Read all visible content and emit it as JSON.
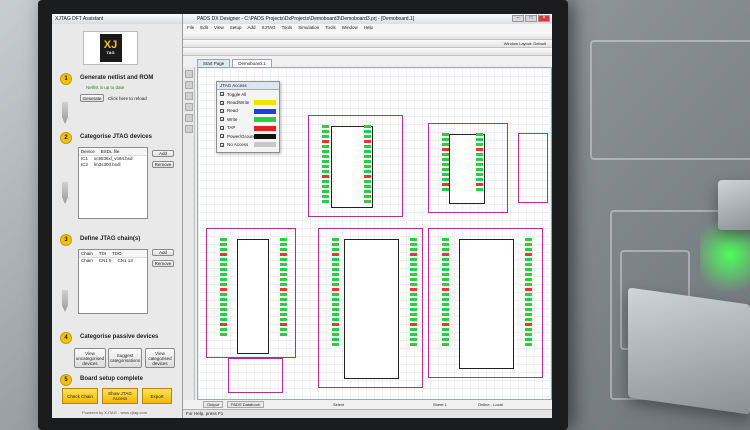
{
  "xjtag": {
    "title": "XJTAG DFT Assistant",
    "logo_main": "XJ",
    "logo_sub": "TAG",
    "steps": [
      {
        "num": "1",
        "title": "Generate netlist and ROM",
        "sub": "Netlist is up to date",
        "button": "Generate",
        "hint": "Click here to reload"
      },
      {
        "num": "2",
        "title": "Categorise JTAG devices",
        "headers": [
          "Device",
          "BSDL file"
        ],
        "rows": [
          [
            "IC1",
            "xc9536xl_vo64.bsd"
          ],
          [
            "IC2",
            "lm3s300.bsdl"
          ]
        ],
        "add": "Add",
        "remove": "Remove"
      },
      {
        "num": "3",
        "title": "Define JTAG chain(s)",
        "headers": [
          "Chain",
          "TDI",
          "TDO"
        ],
        "rows": [
          [
            "Chain",
            "CN1 5",
            "CN1 13"
          ]
        ],
        "add": "Add",
        "remove": "Remove"
      },
      {
        "num": "4",
        "title": "Categorise passive devices",
        "buttons": [
          "View uncategorised devices",
          "Suggest categorisations",
          "View categorised devices"
        ]
      },
      {
        "num": "5",
        "title": "Board setup complete",
        "buttons": [
          "Check Chain",
          "Show JTAG Access",
          "Export"
        ]
      }
    ],
    "footer": "Powered by XJTAG - www.xjtag.com"
  },
  "pads": {
    "title": "PADS DX Designer - C:\\PADS Projects\\DxProjects\\Demoboard3\\Demoboard3.prj - [Demoboard.1]",
    "menu": [
      "File",
      "Edit",
      "View",
      "Setup",
      "Add",
      "XJTAG",
      "Tools",
      "Simulation",
      "Tools",
      "Window",
      "Help"
    ],
    "tabs": [
      "Start Page",
      "Demoboard.1"
    ],
    "window_layout": "Window Layout: Default",
    "jtag_panel": {
      "title": "JTAG Access",
      "items": [
        {
          "label": "Toggle All",
          "color": ""
        },
        {
          "label": "Read/Write",
          "color": "#f2e400"
        },
        {
          "label": "Read",
          "color": "#1f3ee0"
        },
        {
          "label": "Write",
          "color": "#2ecc40"
        },
        {
          "label": "TAP",
          "color": "#e02020"
        },
        {
          "label": "Power/Ground",
          "color": "#111111"
        },
        {
          "label": "No Access",
          "color": "#c8c8c8"
        }
      ]
    },
    "status_left": "For Help, press F1",
    "status_tabs": [
      "Output",
      "PADS Databook"
    ],
    "status_sheet": "Sheet 1",
    "status_mode": "Online - Local",
    "status_mid": "Select"
  }
}
